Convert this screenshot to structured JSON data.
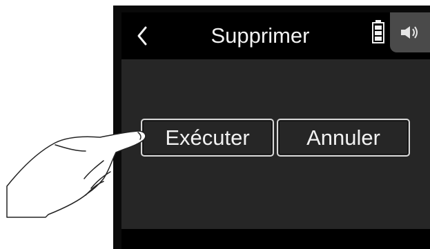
{
  "header": {
    "title": "Supprimer",
    "back_icon": "chevron-left-icon",
    "battery_icon": "battery-full-icon",
    "speaker_icon": "speaker-icon"
  },
  "dialog": {
    "execute_label": "Exécuter",
    "cancel_label": "Annuler"
  },
  "colors": {
    "screen_bg": "#262626",
    "header_bg": "#000000",
    "text": "#f2f2f2",
    "button_border": "#d9d9d9",
    "speaker_tab": "#4a4a4a"
  }
}
